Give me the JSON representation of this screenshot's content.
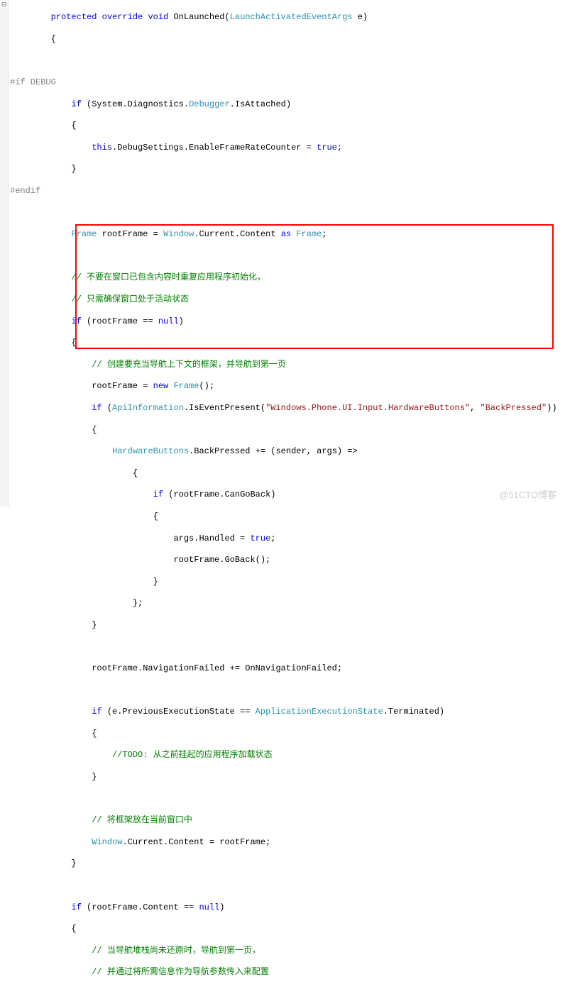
{
  "directive1": "#if DEBUG",
  "directive2": "#endif",
  "code": {
    "l1a": "        ",
    "l1b": "protected",
    "l1c": " ",
    "l1d": "override",
    "l1e": " ",
    "l1f": "void",
    "l1g": " OnLaunched(",
    "l1h": "LaunchActivatedEventArgs",
    "l1i": " e)",
    "l2": "        {",
    "l5a": "            ",
    "l5b": "if",
    "l5c": " (System.Diagnostics.",
    "l5d": "Debugger",
    "l5e": ".IsAttached)",
    "l6": "            {",
    "l7a": "                ",
    "l7b": "this",
    "l7c": ".DebugSettings.EnableFrameRateCounter = ",
    "l7d": "true",
    "l7e": ";",
    "l8": "            }",
    "l11a": "            ",
    "l11b": "Frame",
    "l11c": " rootFrame = ",
    "l11d": "Window",
    "l11e": ".Current.Content ",
    "l11f": "as",
    "l11g": " ",
    "l11h": "Frame",
    "l11i": ";",
    "l13a": "            ",
    "l13b": "// 不要在窗口已包含内容时重复应用程序初始化，",
    "l14a": "            ",
    "l14b": "// 只需确保窗口处于活动状态",
    "l15a": "            ",
    "l15b": "if",
    "l15c": " (rootFrame == ",
    "l15d": "null",
    "l15e": ")",
    "l16": "            {",
    "l17a": "                ",
    "l17b": "// 创建要充当导航上下文的框架，并导航到第一页",
    "l18a": "                rootFrame = ",
    "l18b": "new",
    "l18c": " ",
    "l18d": "Frame",
    "l18e": "();",
    "l19a": "                ",
    "l19b": "if",
    "l19c": " (",
    "l19d": "ApiInformation",
    "l19e": ".IsEventPresent(",
    "l19f": "\"Windows.Phone.UI.Input.HardwareButtons\"",
    "l19g": ", ",
    "l19h": "\"BackPressed\"",
    "l19i": "))",
    "l20": "                {",
    "l21a": "                    ",
    "l21b": "HardwareButtons",
    "l21c": ".BackPressed += (sender, args) =>",
    "l22": "                        {",
    "l23a": "                            ",
    "l23b": "if",
    "l23c": " (rootFrame.CanGoBack)",
    "l24": "                            {",
    "l25a": "                                args.Handled = ",
    "l25b": "true",
    "l25c": ";",
    "l26": "                                rootFrame.GoBack();",
    "l27": "                            }",
    "l28": "                        };",
    "l29": "                }",
    "l31": "                rootFrame.NavigationFailed += OnNavigationFailed;",
    "l33a": "                ",
    "l33b": "if",
    "l33c": " (e.PreviousExecutionState == ",
    "l33d": "ApplicationExecutionState",
    "l33e": ".Terminated)",
    "l34": "                {",
    "l35a": "                    ",
    "l35b": "//TODO: 从之前挂起的应用程序加载状态",
    "l36": "                }",
    "l38a": "                ",
    "l38b": "// 将框架放在当前窗口中",
    "l39a": "                ",
    "l39b": "Window",
    "l39c": ".Current.Content = rootFrame;",
    "l40": "            }",
    "l42a": "            ",
    "l42b": "if",
    "l42c": " (rootFrame.Content == ",
    "l42d": "null",
    "l42e": ")",
    "l43": "            {",
    "l44a": "                ",
    "l44b": "// 当导航堆栈尚未还原时，导航到第一页，",
    "l45a": "                ",
    "l45b": "// 并通过将所需信息作为导航参数传入来配置"
  },
  "watermark": "@51CTO博客"
}
